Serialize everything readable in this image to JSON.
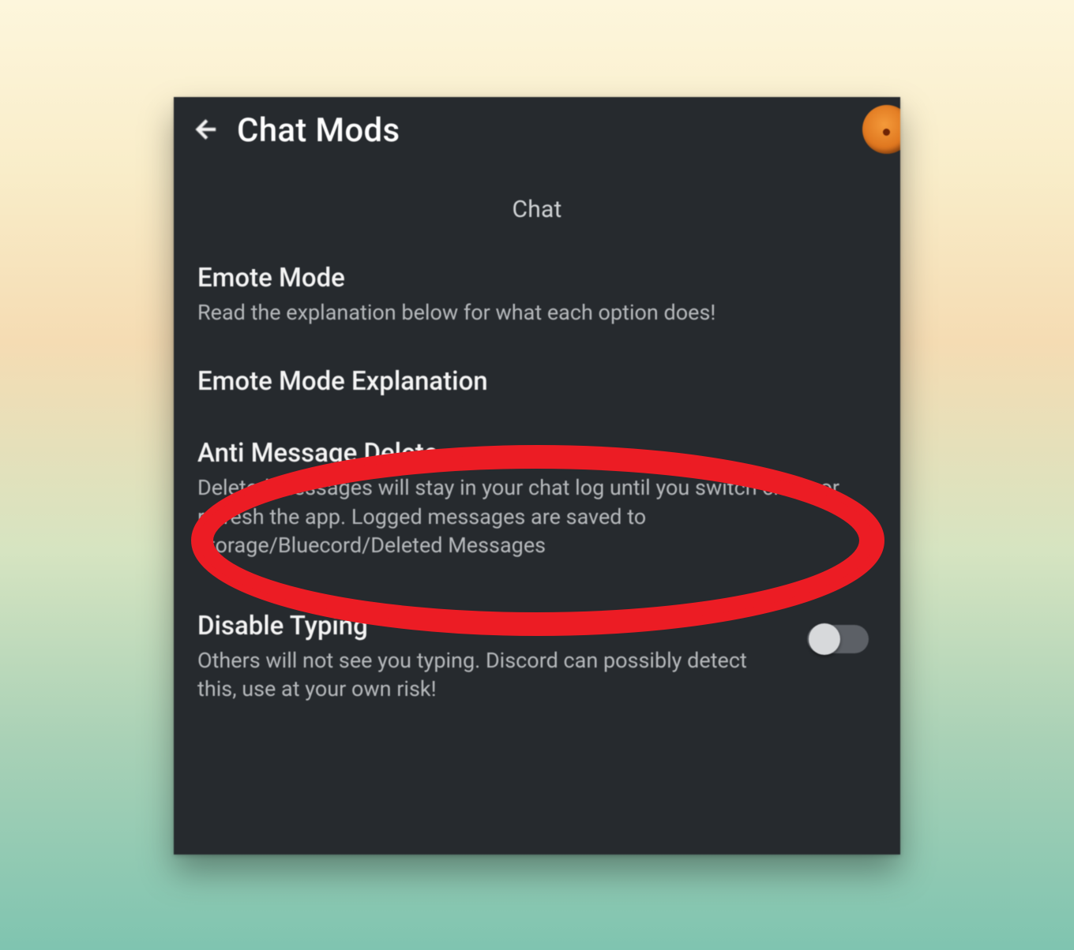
{
  "header": {
    "title": "Chat Mods"
  },
  "section": {
    "heading": "Chat"
  },
  "rows": {
    "emote_mode": {
      "title": "Emote Mode",
      "desc": "Read the explanation below for what each option does!"
    },
    "emote_mode_explanation": {
      "title": "Emote Mode Explanation"
    },
    "anti_message_delete": {
      "title": "Anti Message Delete",
      "desc": "Deleted messages will stay in your chat log until you switch chats or refresh the app. Logged messages are saved to storage/Bluecord/Deleted Messages"
    },
    "disable_typing": {
      "title": "Disable Typing",
      "desc": "Others will not see you typing. Discord can possibly detect this, use at your own risk!",
      "toggle_state": "off"
    }
  },
  "annotation": {
    "target": "anti_message_delete",
    "shape": "ellipse",
    "color": "#ec1c24"
  }
}
